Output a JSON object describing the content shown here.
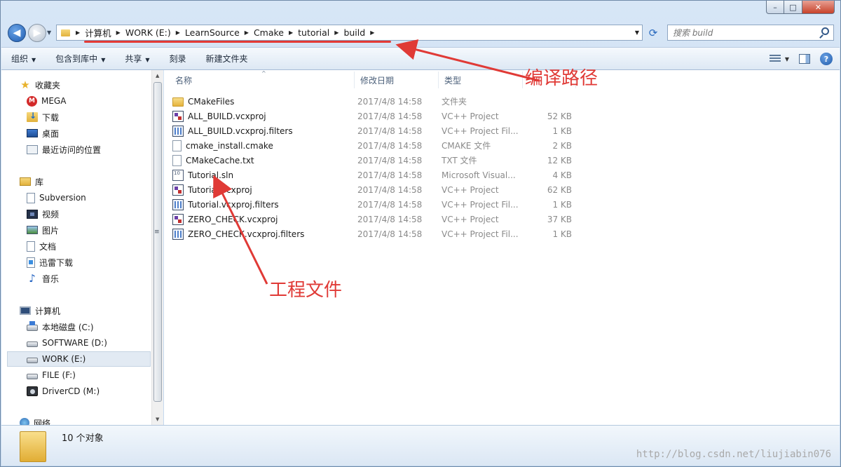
{
  "window": {
    "caption_min": "–",
    "caption_max": "□",
    "caption_close": "✕"
  },
  "address": {
    "back": "◀",
    "forward": "▶",
    "breadcrumbs": [
      "计算机",
      "WORK (E:)",
      "LearnSource",
      "Cmake",
      "tutorial",
      "build"
    ],
    "refresh": "⟳",
    "search_placeholder": "搜索 build"
  },
  "toolbar": {
    "organize": "组织",
    "include_in_library": "包含到库中",
    "share": "共享",
    "burn": "刻录",
    "new_folder": "新建文件夹",
    "help": "?"
  },
  "navpane": {
    "favorites": {
      "label": "收藏夹",
      "items": [
        {
          "label": "MEGA",
          "icon": "mega-icon"
        },
        {
          "label": "下载",
          "icon": "downloads-folder-icon"
        },
        {
          "label": "桌面",
          "icon": "desktop-icon"
        },
        {
          "label": "最近访问的位置",
          "icon": "recent-places-icon"
        }
      ]
    },
    "libraries": {
      "label": "库",
      "items": [
        {
          "label": "Subversion",
          "icon": "subversion-icon"
        },
        {
          "label": "视频",
          "icon": "video-icon"
        },
        {
          "label": "图片",
          "icon": "pictures-icon"
        },
        {
          "label": "文档",
          "icon": "documents-icon"
        },
        {
          "label": "迅雷下载",
          "icon": "xunlei-download-icon"
        },
        {
          "label": "音乐",
          "icon": "music-icon"
        }
      ]
    },
    "computer": {
      "label": "计算机",
      "items": [
        {
          "label": "本地磁盘 (C:)",
          "icon": "system-drive-icon"
        },
        {
          "label": "SOFTWARE (D:)",
          "icon": "drive-icon"
        },
        {
          "label": "WORK (E:)",
          "icon": "drive-icon",
          "selected": true
        },
        {
          "label": "FILE (F:)",
          "icon": "drive-icon"
        },
        {
          "label": "DriverCD (M:)",
          "icon": "cd-drive-icon"
        }
      ]
    },
    "network": {
      "label": "网络"
    }
  },
  "columns": {
    "name": "名称",
    "date": "修改日期",
    "type": "类型",
    "size": ""
  },
  "files": [
    {
      "name": "CMakeFiles",
      "date": "2017/4/8 14:58",
      "type": "文件夹",
      "size": "",
      "icon": "folder"
    },
    {
      "name": "ALL_BUILD.vcxproj",
      "date": "2017/4/8 14:58",
      "type": "VC++ Project",
      "size": "52 KB",
      "icon": "proj"
    },
    {
      "name": "ALL_BUILD.vcxproj.filters",
      "date": "2017/4/8 14:58",
      "type": "VC++ Project Fil...",
      "size": "1 KB",
      "icon": "filt"
    },
    {
      "name": "cmake_install.cmake",
      "date": "2017/4/8 14:58",
      "type": "CMAKE 文件",
      "size": "2 KB",
      "icon": "doc"
    },
    {
      "name": "CMakeCache.txt",
      "date": "2017/4/8 14:58",
      "type": "TXT 文件",
      "size": "12 KB",
      "icon": "doc"
    },
    {
      "name": "Tutorial.sln",
      "date": "2017/4/8 14:58",
      "type": "Microsoft Visual...",
      "size": "4 KB",
      "icon": "sln"
    },
    {
      "name": "Tutorial.vcxproj",
      "date": "2017/4/8 14:58",
      "type": "VC++ Project",
      "size": "62 KB",
      "icon": "proj"
    },
    {
      "name": "Tutorial.vcxproj.filters",
      "date": "2017/4/8 14:58",
      "type": "VC++ Project Fil...",
      "size": "1 KB",
      "icon": "filt"
    },
    {
      "name": "ZERO_CHECK.vcxproj",
      "date": "2017/4/8 14:58",
      "type": "VC++ Project",
      "size": "37 KB",
      "icon": "proj"
    },
    {
      "name": "ZERO_CHECK.vcxproj.filters",
      "date": "2017/4/8 14:58",
      "type": "VC++ Project Fil...",
      "size": "1 KB",
      "icon": "filt"
    }
  ],
  "status": {
    "count": "10 个对象"
  },
  "watermark": "http://blog.csdn.net/liujiabin076",
  "annotations": {
    "build_path": "编译路径",
    "project_file": "工程文件"
  },
  "colors": {
    "annotation": "#e03a36",
    "accent": "#1d5bb0"
  }
}
